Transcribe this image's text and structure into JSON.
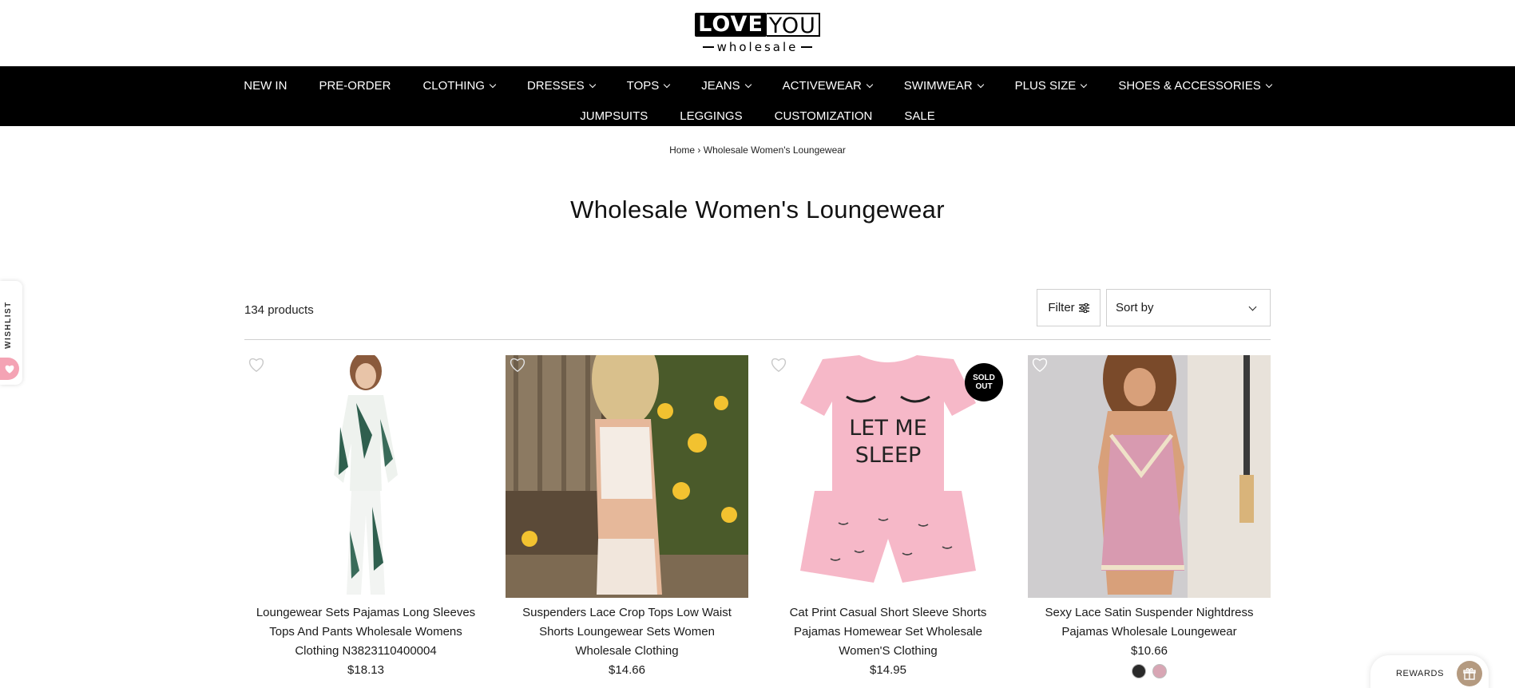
{
  "brand": {
    "love": "LOVE",
    "you": "YOU",
    "sub": "wholesale"
  },
  "nav": {
    "row1": [
      {
        "label": "NEW IN",
        "dropdown": false
      },
      {
        "label": "PRE-ORDER",
        "dropdown": false
      },
      {
        "label": "CLOTHING",
        "dropdown": true
      },
      {
        "label": "DRESSES",
        "dropdown": true
      },
      {
        "label": "TOPS",
        "dropdown": true
      },
      {
        "label": "JEANS",
        "dropdown": true
      },
      {
        "label": "ACTIVEWEAR",
        "dropdown": true
      },
      {
        "label": "SWIMWEAR",
        "dropdown": true
      },
      {
        "label": "PLUS SIZE",
        "dropdown": true
      },
      {
        "label": "SHOES & ACCESSORIES",
        "dropdown": true
      }
    ],
    "row2": [
      {
        "label": "JUMPSUITS",
        "dropdown": false
      },
      {
        "label": "LEGGINGS",
        "dropdown": false
      },
      {
        "label": "CUSTOMIZATION",
        "dropdown": false
      },
      {
        "label": "SALE",
        "dropdown": false
      }
    ]
  },
  "breadcrumb": {
    "home": "Home",
    "separator": "›",
    "current": "Wholesale Women's Loungewear"
  },
  "page_title": "Wholesale Women's Loungewear",
  "toolbar": {
    "count": "134 products",
    "filter_label": "Filter",
    "sort_label": "Sort by"
  },
  "products": [
    {
      "title": "Loungewear Sets Pajamas Long Sleeves Tops And Pants Wholesale Womens Clothing N3823110400004",
      "price": "$18.13",
      "sold_out": false
    },
    {
      "title": "Suspenders Lace Crop Tops Low Waist Shorts Loungewear Sets Women Wholesale Clothing",
      "price": "$14.66",
      "sold_out": false
    },
    {
      "title": "Cat Print Casual Short Sleeve Shorts Pajamas Homewear Set Wholesale Women'S Clothing",
      "price": "$14.95",
      "sold_out": true,
      "badge": "SOLD OUT",
      "print_text": "LET ME SLEEP"
    },
    {
      "title": "Sexy Lace Satin Suspender Nightdress Pajamas Wholesale Loungewear",
      "price": "$10.66",
      "sold_out": false,
      "swatches": [
        "#2a2a2a",
        "#d8a6b4"
      ]
    }
  ],
  "wishlist": {
    "label": "WISHLIST"
  },
  "rewards": {
    "label": "REWARDS"
  },
  "colors": {
    "nav_bg": "#000000",
    "nav_text": "#ffffff",
    "wishlist_pink": "#f4a3b4",
    "rewards_icon": "#b49a80"
  },
  "icons": {
    "heart": "heart-icon",
    "filter": "sliders-icon",
    "sort": "chevron-down-icon",
    "gift": "gift-icon"
  }
}
